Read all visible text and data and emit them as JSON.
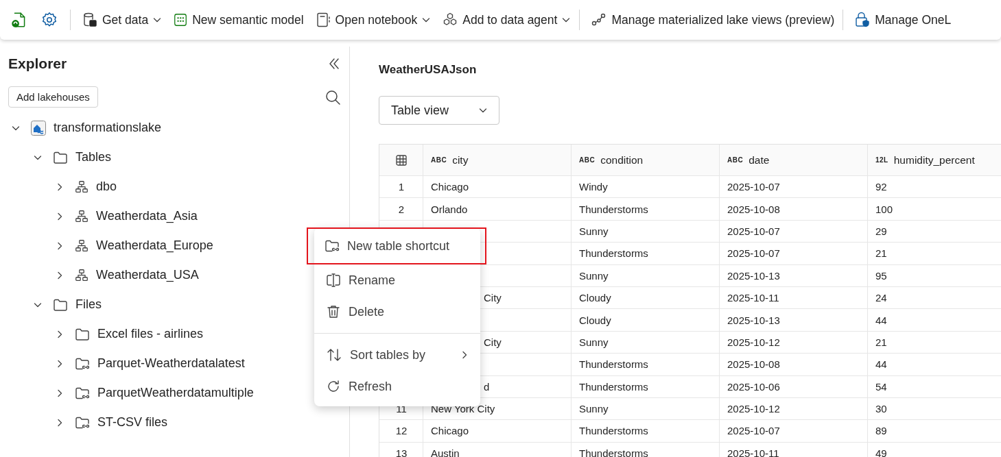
{
  "toolbar": {
    "items": [
      {
        "kind": "icon"
      },
      {
        "kind": "icon"
      },
      {
        "kind": "divider"
      },
      {
        "kind": "button",
        "label": "Get data",
        "dropdown": true
      },
      {
        "kind": "button",
        "label": "New semantic model",
        "dropdown": false
      },
      {
        "kind": "button",
        "label": "Open notebook",
        "dropdown": true
      },
      {
        "kind": "button",
        "label": "Add to data agent",
        "dropdown": true
      },
      {
        "kind": "divider"
      },
      {
        "kind": "button",
        "label": "Manage materialized lake views (preview)",
        "dropdown": false
      },
      {
        "kind": "divider"
      },
      {
        "kind": "button",
        "label": "Manage OneL",
        "dropdown": false
      }
    ]
  },
  "explorer": {
    "title": "Explorer",
    "add_button": "Add lakehouses",
    "tree": [
      {
        "label": "transformationslake",
        "kind": "lakehouse",
        "expanded": true,
        "children": [
          {
            "label": "Tables",
            "kind": "folder",
            "expanded": true,
            "children": [
              {
                "label": "dbo",
                "kind": "schema",
                "expanded": false
              },
              {
                "label": "Weatherdata_Asia",
                "kind": "schema",
                "expanded": false
              },
              {
                "label": "Weatherdata_Europe",
                "kind": "schema",
                "expanded": false
              },
              {
                "label": "Weatherdata_USA",
                "kind": "schema",
                "expanded": false
              }
            ]
          },
          {
            "label": "Files",
            "kind": "folder",
            "expanded": true,
            "children": [
              {
                "label": "Excel files - airlines",
                "kind": "folder",
                "expanded": false
              },
              {
                "label": "Parquet-Weatherdatalatest",
                "kind": "shortcut",
                "expanded": false
              },
              {
                "label": "ParquetWeatherdatamultiple",
                "kind": "shortcut",
                "expanded": false
              },
              {
                "label": "ST-CSV files",
                "kind": "shortcut",
                "expanded": false
              }
            ]
          }
        ]
      }
    ]
  },
  "content": {
    "title": "WeatherUSAJson",
    "view_select": "Table view",
    "table": {
      "columns": [
        {
          "type": "ABC",
          "name": "city"
        },
        {
          "type": "ABC",
          "name": "condition"
        },
        {
          "type": "ABC",
          "name": "date"
        },
        {
          "type": "12L",
          "name": "humidity_percent"
        }
      ],
      "rows": [
        {
          "index": "1",
          "cells": [
            "Chicago",
            "Windy",
            "2025-10-07",
            "92"
          ]
        },
        {
          "index": "2",
          "cells": [
            "Orlando",
            "Thunderstorms",
            "2025-10-08",
            "100"
          ]
        },
        {
          "cells": [
            "",
            "Sunny",
            "2025-10-07",
            "29"
          ]
        },
        {
          "cells": [
            "",
            "Thunderstorms",
            "2025-10-07",
            "21"
          ]
        },
        {
          "cells": [
            "",
            "Sunny",
            "2025-10-13",
            "95"
          ]
        },
        {
          "cells": [
            "City",
            "Cloudy",
            "2025-10-11",
            "24"
          ],
          "partial": true
        },
        {
          "cells": [
            "",
            "Cloudy",
            "2025-10-13",
            "44"
          ]
        },
        {
          "cells": [
            "City",
            "Sunny",
            "2025-10-12",
            "21"
          ],
          "partial": true
        },
        {
          "cells": [
            "",
            "Thunderstorms",
            "2025-10-08",
            "44"
          ]
        },
        {
          "cells": [
            "d",
            "Thunderstorms",
            "2025-10-06",
            "54"
          ],
          "partial": true
        },
        {
          "index": "11",
          "cells": [
            "New York City",
            "Sunny",
            "2025-10-12",
            "30"
          ]
        },
        {
          "index": "12",
          "cells": [
            "Chicago",
            "Thunderstorms",
            "2025-10-07",
            "89"
          ]
        },
        {
          "index": "13",
          "cells": [
            "Austin",
            "Thunderstorms",
            "2025-10-11",
            "49"
          ]
        }
      ]
    }
  },
  "context_menu": {
    "items": [
      {
        "kind": "item",
        "label": "New table shortcut",
        "highlighted": true
      },
      {
        "kind": "item",
        "label": "Rename",
        "highlighted": false
      },
      {
        "kind": "item",
        "label": "Delete",
        "highlighted": false
      },
      {
        "kind": "divider"
      },
      {
        "kind": "submenu",
        "label": "Sort tables by",
        "highlighted": false
      },
      {
        "kind": "item",
        "label": "Refresh",
        "highlighted": false
      }
    ]
  }
}
